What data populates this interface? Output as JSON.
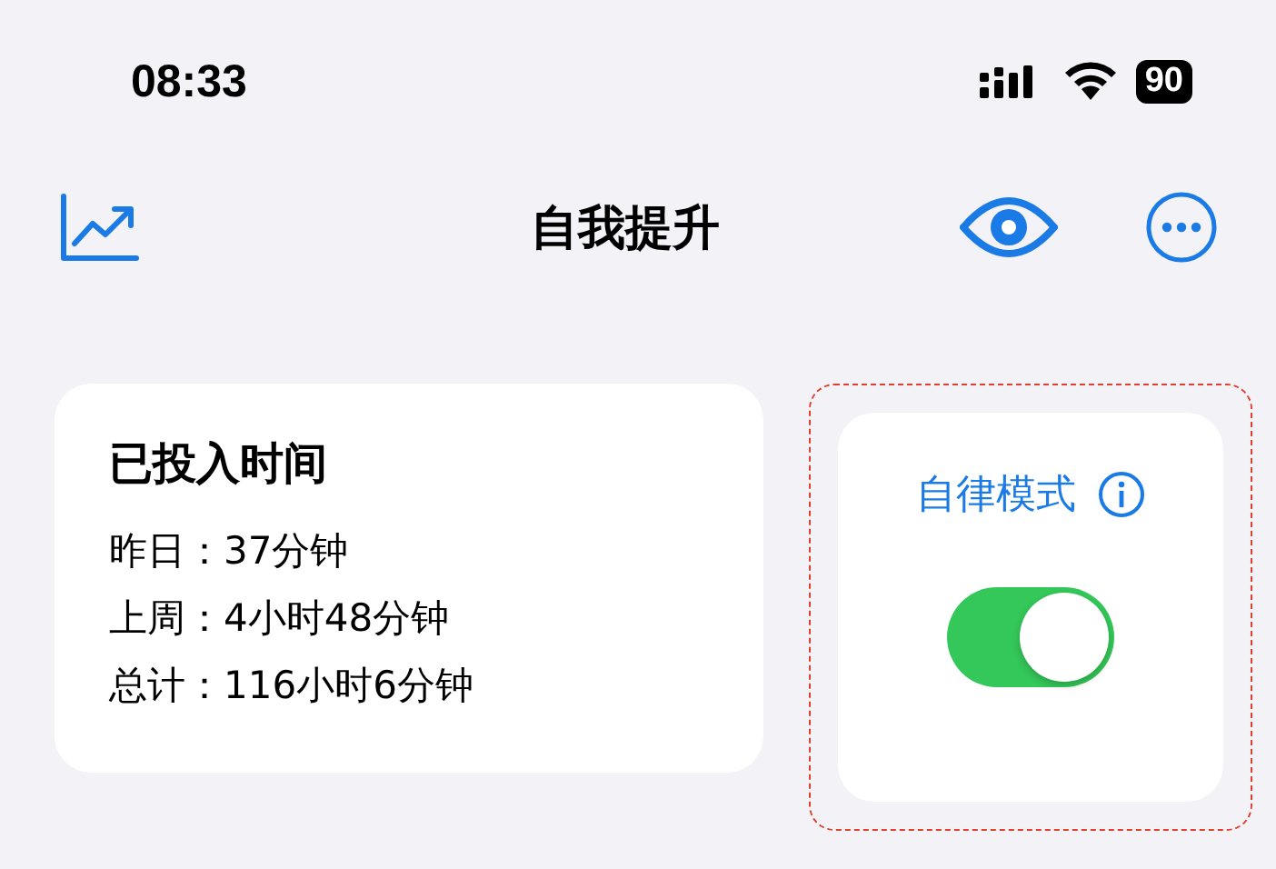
{
  "status_bar": {
    "time": "08:33",
    "battery": "90"
  },
  "nav_bar": {
    "title": "自我提升"
  },
  "time_card": {
    "title": "已投入时间",
    "lines": [
      "昨日：37分钟",
      "上周：4小时48分钟",
      "总计：116小时6分钟"
    ]
  },
  "mode_card": {
    "label": "自律模式",
    "highlighted": true,
    "toggle": {
      "on": true
    }
  }
}
